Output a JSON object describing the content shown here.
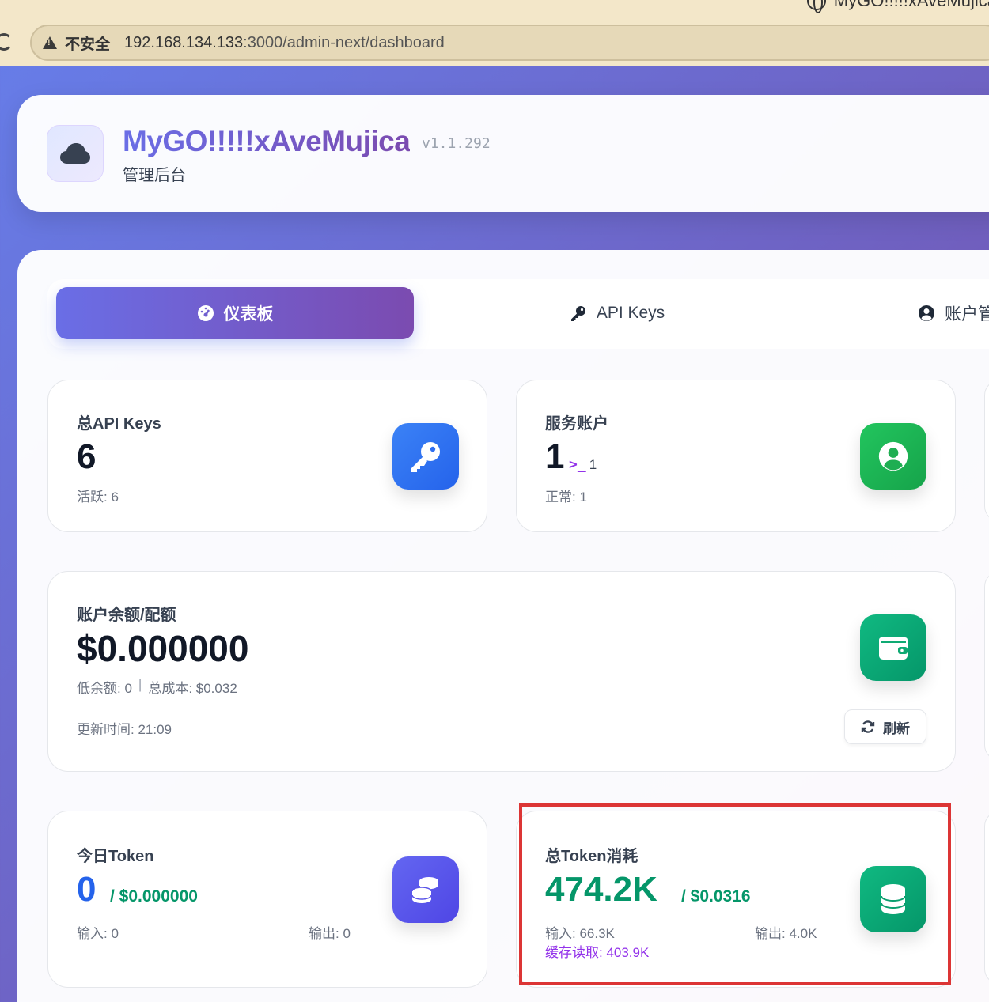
{
  "browser": {
    "window_title": "MyGO!!!!!xAveMujica",
    "insecure_label": "不安全",
    "url_host": "192.168.134.133",
    "url_rest": ":3000/admin-next/dashboard"
  },
  "header": {
    "title": "MyGO!!!!!xAveMujica",
    "version": "v1.1.292",
    "subtitle": "管理后台"
  },
  "tabs": [
    {
      "label": "仪表板",
      "icon": "gauge-icon",
      "active": true
    },
    {
      "label": "API Keys",
      "icon": "key-icon",
      "active": false
    },
    {
      "label": "账户管",
      "icon": "user-circle-icon",
      "active": false
    }
  ],
  "stats": {
    "api_keys": {
      "title": "总API Keys",
      "value": "6",
      "sub": "活跃: 6",
      "icon": "key-icon",
      "color": "#2563eb"
    },
    "service_accounts": {
      "title": "服务账户",
      "value": "1",
      "platform_count": "1",
      "sub": "正常: 1",
      "icon": "user-circle-icon",
      "color": "#16a34a"
    },
    "balance": {
      "title": "账户余额/配额",
      "value": "$0.000000",
      "low_balance": "低余额: 0",
      "total_cost": "总成本: $0.032",
      "updated": "更新时间: 21:09",
      "refresh_label": "刷新",
      "icon": "wallet-icon",
      "color": "#10b981"
    },
    "today_token": {
      "title": "今日Token",
      "value": "0",
      "cost": "/ $0.000000",
      "input": "输入: 0",
      "output": "输出: 0",
      "icon": "coins-icon",
      "color": "#6366f1"
    },
    "total_token": {
      "title": "总Token消耗",
      "value": "474.2K",
      "cost": "/ $0.0316",
      "input": "输入: 66.3K",
      "output": "输出: 4.0K",
      "cache_read": "缓存读取: 403.9K",
      "icon": "database-icon",
      "color": "#059669"
    }
  }
}
